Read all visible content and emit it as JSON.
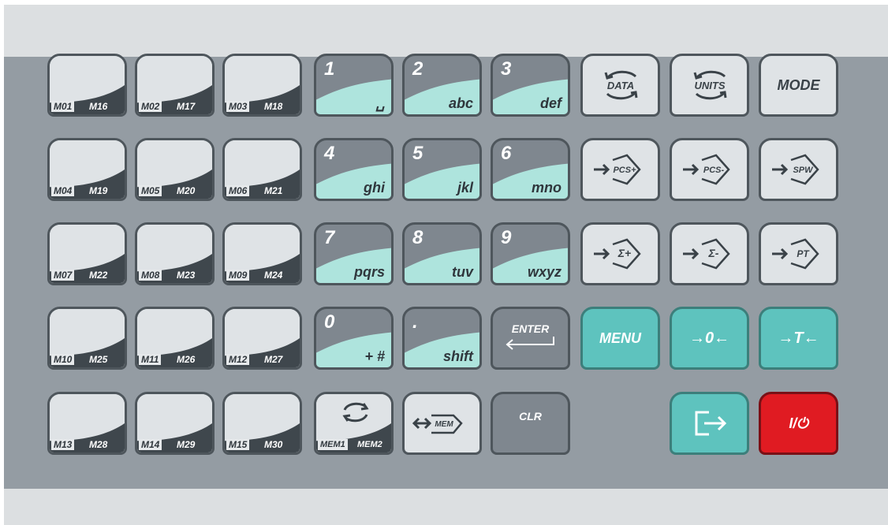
{
  "keypad": {
    "memory_keys": [
      {
        "l": "M01",
        "r": "M16"
      },
      {
        "l": "M02",
        "r": "M17"
      },
      {
        "l": "M03",
        "r": "M18"
      },
      {
        "l": "M04",
        "r": "M19"
      },
      {
        "l": "M05",
        "r": "M20"
      },
      {
        "l": "M06",
        "r": "M21"
      },
      {
        "l": "M07",
        "r": "M22"
      },
      {
        "l": "M08",
        "r": "M23"
      },
      {
        "l": "M09",
        "r": "M24"
      },
      {
        "l": "M10",
        "r": "M25"
      },
      {
        "l": "M11",
        "r": "M26"
      },
      {
        "l": "M12",
        "r": "M27"
      },
      {
        "l": "M13",
        "r": "M28"
      },
      {
        "l": "M14",
        "r": "M29"
      },
      {
        "l": "M15",
        "r": "M30"
      }
    ],
    "numeric_keys": [
      {
        "d": "1",
        "t": "␣"
      },
      {
        "d": "2",
        "t": "abc"
      },
      {
        "d": "3",
        "t": "def"
      },
      {
        "d": "4",
        "t": "ghi"
      },
      {
        "d": "5",
        "t": "jkl"
      },
      {
        "d": "6",
        "t": "mno"
      },
      {
        "d": "7",
        "t": "pqrs"
      },
      {
        "d": "8",
        "t": "tuv"
      },
      {
        "d": "9",
        "t": "wxyz"
      },
      {
        "d": "0",
        "t": "+ #"
      },
      {
        "d": ".",
        "t": "shift"
      }
    ],
    "enter_label": "ENTER",
    "clr_label": "CLR",
    "mem_swap": {
      "l": "MEM1",
      "r": "MEM2"
    },
    "mem_key_label": "MEM",
    "function_keys": {
      "data": "DATA",
      "units": "UNITS",
      "mode": "MODE",
      "pcs_plus": "PCS+",
      "pcs_minus": "PCS-",
      "spw": "SPW",
      "sum_plus": "Σ+",
      "sum_minus": "Σ-",
      "pt": "PT",
      "menu": "MENU",
      "zero": "→0←",
      "tare": "→T←",
      "power": "I/⏻"
    },
    "colors": {
      "teal": "#5ec3be",
      "red": "#e01b22",
      "panel": "#949ca3"
    }
  }
}
